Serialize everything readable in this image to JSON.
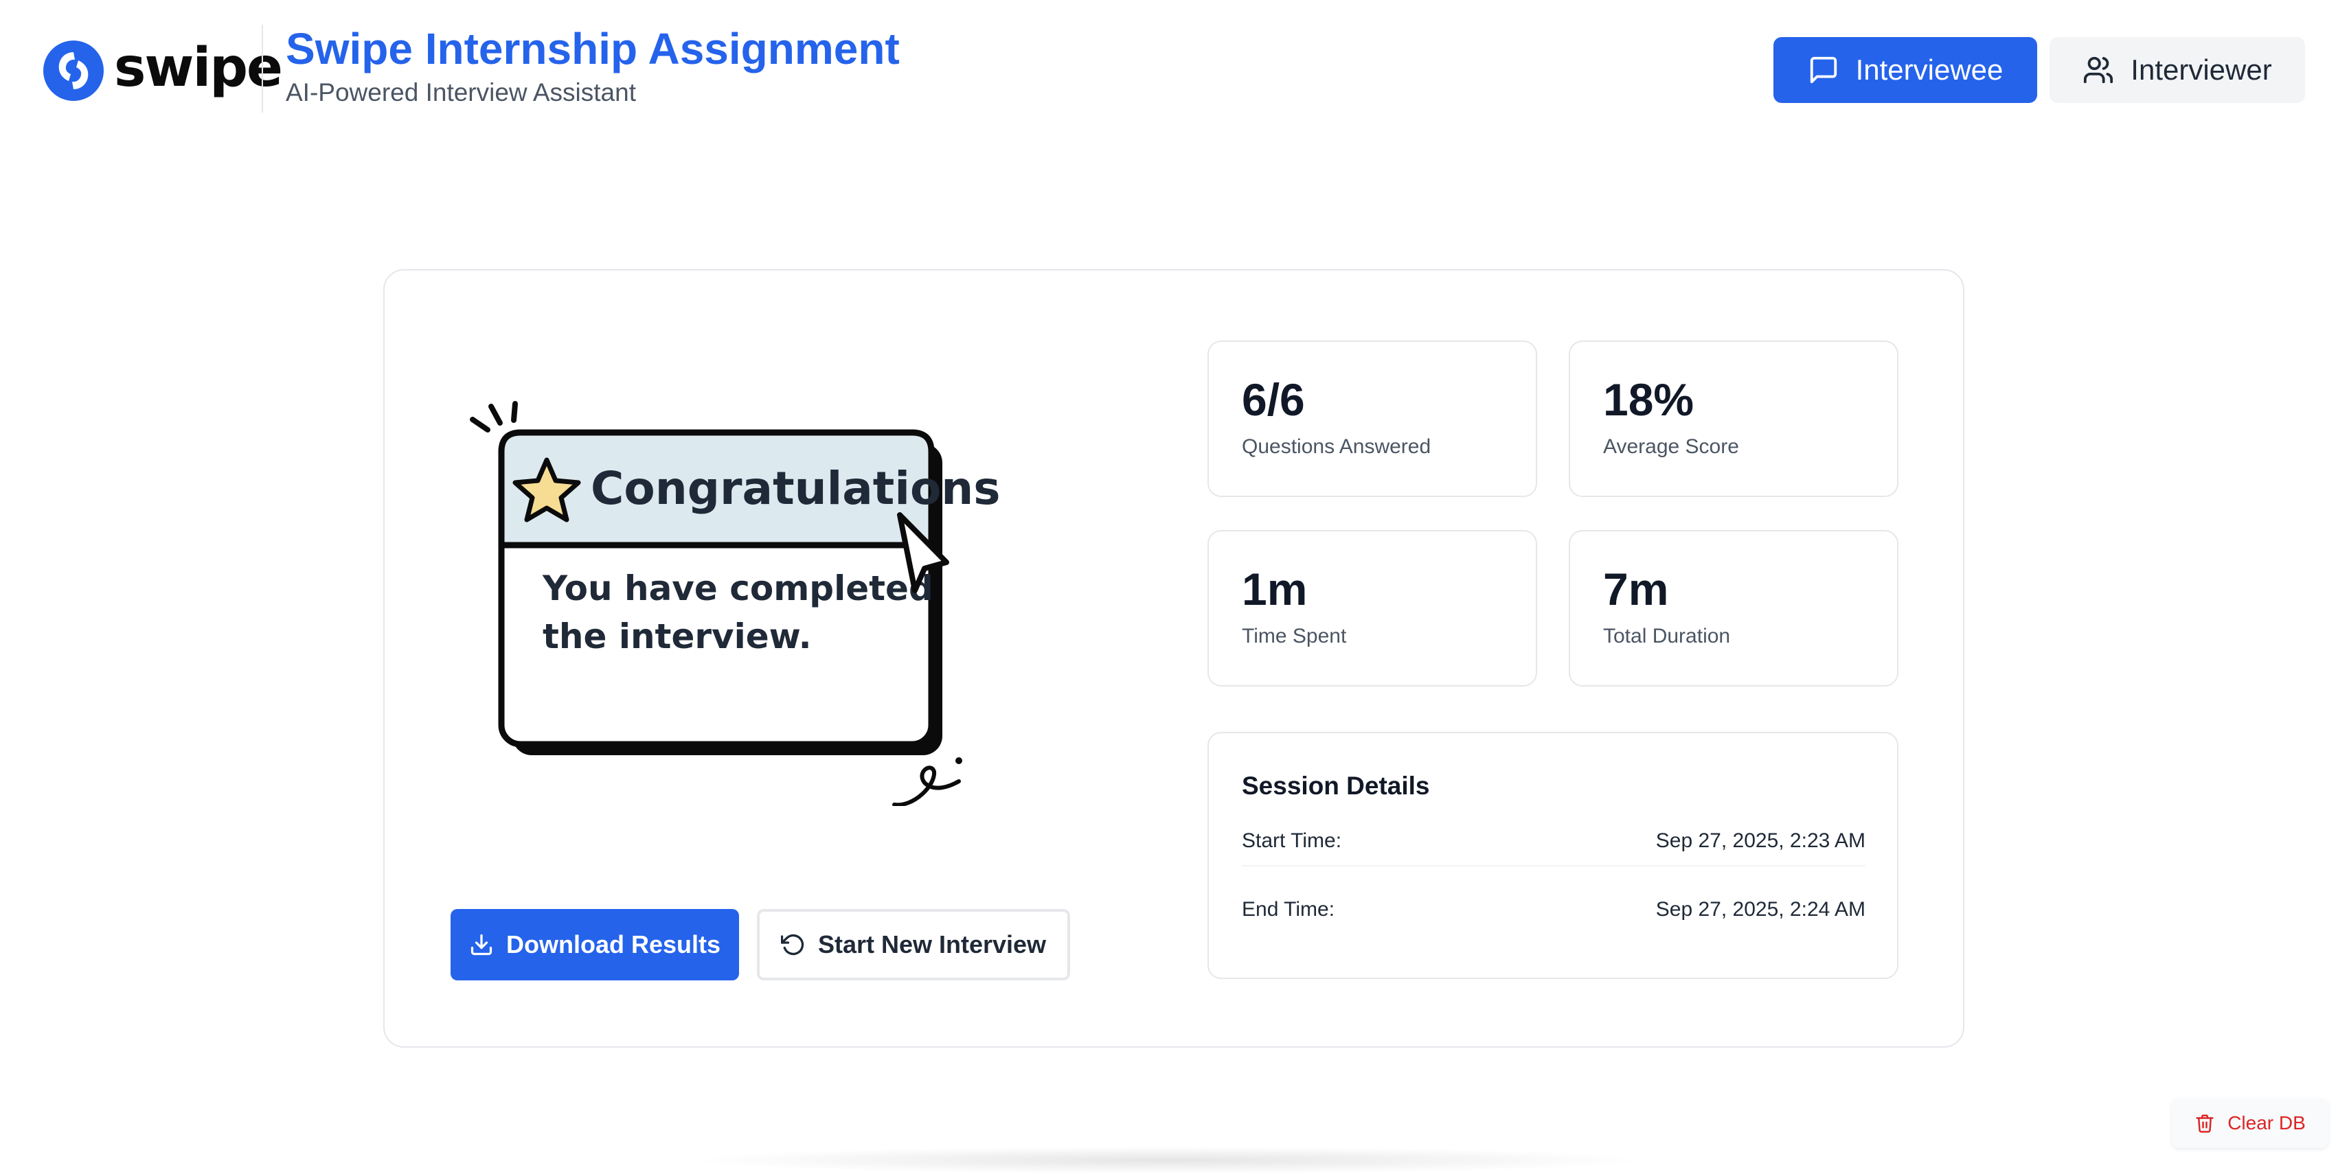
{
  "header": {
    "logo_text": "swipe",
    "title": "Swipe Internship Assignment",
    "subtitle": "AI-Powered Interview Assistant",
    "tabs": [
      {
        "label": "Interviewee",
        "icon": "message-square-icon",
        "active": true
      },
      {
        "label": "Interviewer",
        "icon": "users-icon",
        "active": false
      }
    ]
  },
  "illustration": {
    "title": "Congratulations",
    "message_line1": "You have completed",
    "message_line2": "the interview."
  },
  "actions": {
    "download_label": "Download Results",
    "restart_label": "Start New Interview"
  },
  "stats": [
    {
      "value": "6/6",
      "label": "Questions Answered"
    },
    {
      "value": "18%",
      "label": "Average Score"
    },
    {
      "value": "1m",
      "label": "Time Spent"
    },
    {
      "value": "7m",
      "label": "Total Duration"
    }
  ],
  "session": {
    "title": "Session Details",
    "rows": [
      {
        "label": "Start Time:",
        "value": "Sep 27, 2025, 2:23 AM"
      },
      {
        "label": "End Time:",
        "value": "Sep 27, 2025, 2:24 AM"
      }
    ]
  },
  "footer": {
    "clear_db_label": "Clear DB"
  },
  "colors": {
    "accent": "#2563eb",
    "danger": "#dc2626",
    "banner": "#dce9ef",
    "star": "#f7dd93"
  }
}
